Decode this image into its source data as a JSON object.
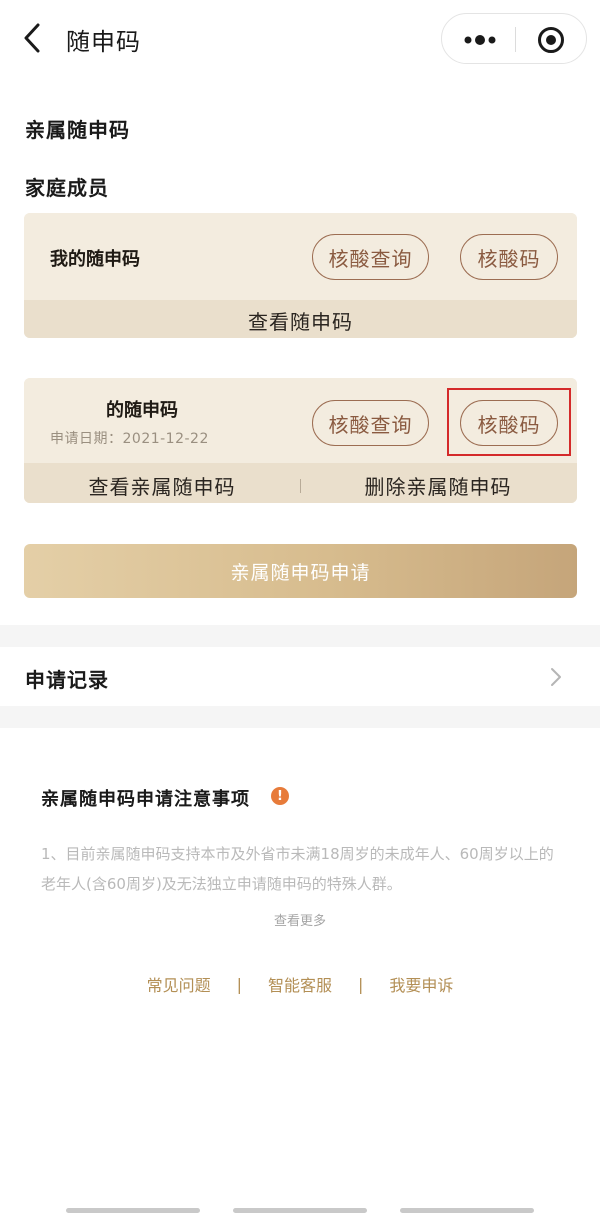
{
  "header": {
    "title": "随申码"
  },
  "family": {
    "section_title": "亲属随申码",
    "members_title": "家庭成员"
  },
  "my_card": {
    "name": "我的随申码",
    "btn_query": "核酸查询",
    "btn_code": "核酸码",
    "view_link": "查看随申码"
  },
  "relative_card": {
    "name": "的随申码",
    "date_label": "申请日期：2021-12-22",
    "btn_query": "核酸查询",
    "btn_code": "核酸码",
    "view_link": "查看亲属随申码",
    "delete_link": "删除亲属随申码"
  },
  "apply_button": "亲属随申码申请",
  "records": {
    "title": "申请记录"
  },
  "notice": {
    "title": "亲属随申码申请注意事项",
    "body": "1、目前亲属随申码支持本市及外省市未满18周岁的未成年人、60周岁以上的老年人(含60周岁)及无法独立申请随申码的特殊人群。",
    "see_more": "查看更多"
  },
  "footer": {
    "faq": "常见问题",
    "service": "智能客服",
    "complaint": "我要申诉"
  },
  "colors": {
    "card_bg": "#efe6d6",
    "pill_border": "#9c6d52",
    "apply_gradient_end": "#c5a57a",
    "highlight_red": "#d42a2a",
    "footer_gold": "#b38f55",
    "info_orange": "#e77b3a"
  }
}
